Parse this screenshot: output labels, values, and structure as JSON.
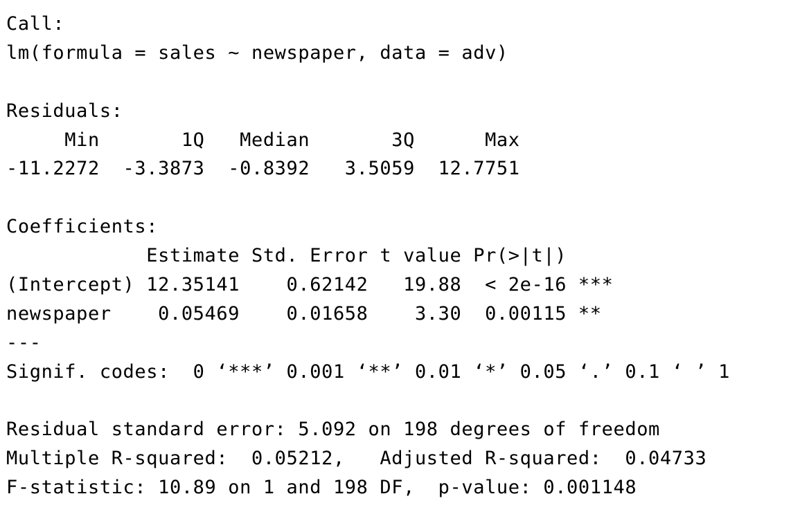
{
  "console": {
    "lines": [
      "Call:",
      "lm(formula = sales ~ newspaper, data = adv)",
      "",
      "Residuals:",
      "     Min       1Q   Median       3Q      Max ",
      "-11.2272  -3.3873  -0.8392   3.5059  12.7751 ",
      "",
      "Coefficients:",
      "            Estimate Std. Error t value Pr(>|t|)    ",
      "(Intercept) 12.35141    0.62142   19.88  < 2e-16 ***",
      "newspaper    0.05469    0.01658    3.30  0.00115 ** ",
      "---",
      "Signif. codes:  0 ‘***’ 0.001 ‘**’ 0.01 ‘*’ 0.05 ‘.’ 0.1 ‘ ’ 1",
      "",
      "Residual standard error: 5.092 on 198 degrees of freedom",
      "Multiple R-squared:  0.05212,\tAdjusted R-squared:  0.04733 ",
      "F-statistic: 10.89 on 1 and 198 DF,  p-value: 0.001148"
    ]
  }
}
